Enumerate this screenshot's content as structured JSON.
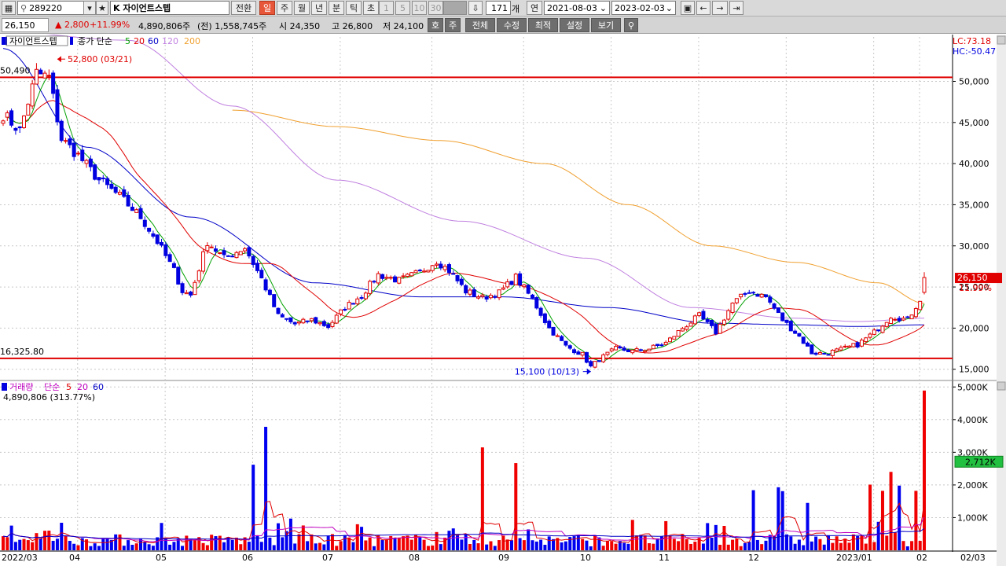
{
  "toolbar": {
    "stock_code": "289220",
    "stock_name": "K 자이언트스텝",
    "convert_label": "전환",
    "period_tabs": [
      "일",
      "주",
      "월",
      "년",
      "분",
      "틱",
      "초"
    ],
    "selected_period": "일",
    "interval_options": [
      "1",
      "5",
      "10",
      "30"
    ],
    "count_value": "171",
    "count_unit": "개",
    "year_label": "연",
    "start_date": "2021-08-03",
    "end_date": "2023-02-03"
  },
  "quote": {
    "price": "26,150",
    "change": "▲ 2,800",
    "change_pct": "+11.99%",
    "volume": "4,890,806주",
    "prev_volume": "(전) 1,558,745주",
    "open": "시 24,350",
    "high": "고 26,800",
    "low": "저 24,100",
    "buttons": [
      "호",
      "주",
      "전체",
      "수정",
      "최적",
      "설정",
      "보기"
    ]
  },
  "legend": {
    "price_title": "자이언트스텝",
    "ma_label": "종가 단순",
    "ma_periods": [
      "5",
      "20",
      "60",
      "120",
      "200"
    ],
    "ma_colors": [
      "#00a000",
      "#e00000",
      "#0000c8",
      "#c080e0",
      "#f0a030"
    ],
    "volume_title": "거래량",
    "volume_ma_label": "단순",
    "volume_ma_periods": [
      "5",
      "20",
      "60"
    ],
    "volume_ma_colors": [
      "#e00000",
      "#c000c0",
      "#0000c8"
    ],
    "volume_info": "4,890,806 (313.77%)"
  },
  "annotations": {
    "lc": "LC:73.18",
    "hc": "HC:-50.47",
    "high_point": "52,800 (03/21)",
    "low_point": "15,100 (10/13)",
    "resistance_label": "50,490",
    "support_label": "16,325.80",
    "current_price_tag": "26,150",
    "current_pct": "11.99%",
    "volume_tag": "2,712K",
    "resistance_value": 50490,
    "support_value": 16325.8
  },
  "chart_data": {
    "type": "candlestick",
    "price_axis": {
      "ticks": [
        15000,
        20000,
        25000,
        30000,
        35000,
        40000,
        45000,
        50000
      ],
      "tick_labels": [
        "15,000",
        "20,000",
        "25,000",
        "30,000",
        "35,000",
        "40,000",
        "45,000",
        "50,000"
      ]
    },
    "volume_axis": {
      "ticks": [
        1000,
        2000,
        3000,
        4000,
        5000
      ],
      "tick_labels": [
        "1,000K",
        "2,000K",
        "3,000K",
        "4,000K",
        "5,000K"
      ]
    },
    "x_labels": [
      "2022/03",
      "04",
      "05",
      "06",
      "07",
      "08",
      "09",
      "10",
      "11",
      "12",
      "2023/01",
      "02",
      "02/03"
    ],
    "close_path": [
      [
        0,
        46000
      ],
      [
        4,
        44000
      ],
      [
        8,
        51000
      ],
      [
        11,
        50500
      ],
      [
        14,
        43000
      ],
      [
        18,
        41000
      ],
      [
        23,
        38000
      ],
      [
        28,
        36000
      ],
      [
        33,
        33500
      ],
      [
        37,
        30500
      ],
      [
        41,
        27000
      ],
      [
        43,
        24500
      ],
      [
        45,
        24000
      ],
      [
        49,
        30500
      ],
      [
        53,
        28500
      ],
      [
        58,
        29800
      ],
      [
        62,
        26000
      ],
      [
        66,
        21500
      ],
      [
        70,
        20500
      ],
      [
        74,
        21000
      ],
      [
        78,
        20200
      ],
      [
        82,
        22500
      ],
      [
        86,
        24000
      ],
      [
        90,
        26500
      ],
      [
        95,
        25800
      ],
      [
        100,
        26800
      ],
      [
        104,
        28200
      ],
      [
        107,
        27000
      ],
      [
        111,
        24500
      ],
      [
        115,
        23700
      ],
      [
        119,
        24300
      ],
      [
        123,
        26200
      ],
      [
        127,
        23500
      ],
      [
        131,
        20000
      ],
      [
        135,
        17800
      ],
      [
        139,
        16800
      ],
      [
        141,
        15300
      ],
      [
        143,
        16200
      ],
      [
        147,
        17500
      ],
      [
        151,
        17200
      ],
      [
        155,
        17500
      ],
      [
        159,
        18200
      ],
      [
        163,
        20000
      ],
      [
        167,
        21500
      ],
      [
        171,
        19500
      ],
      [
        175,
        23000
      ],
      [
        179,
        24500
      ],
      [
        183,
        23800
      ],
      [
        187,
        21000
      ],
      [
        191,
        19000
      ],
      [
        194,
        17000
      ],
      [
        197,
        16900
      ],
      [
        201,
        17400
      ],
      [
        205,
        18000
      ],
      [
        209,
        19500
      ],
      [
        213,
        21500
      ],
      [
        217,
        21000
      ],
      [
        220,
        23500
      ],
      [
        221,
        26150
      ]
    ],
    "vol_hot": [
      [
        63,
        3780
      ],
      [
        60,
        2620
      ],
      [
        69,
        970
      ],
      [
        115,
        3150
      ],
      [
        123,
        2670
      ],
      [
        151,
        930
      ],
      [
        180,
        1840
      ],
      [
        186,
        1930
      ],
      [
        187,
        1810
      ],
      [
        193,
        1450
      ],
      [
        208,
        2010
      ],
      [
        211,
        1820
      ],
      [
        213,
        2400
      ],
      [
        215,
        1980
      ],
      [
        219,
        1820
      ],
      [
        221,
        4890
      ]
    ],
    "ma_curves": {
      "ma5": "close-path smoothing",
      "ma20": "lagged smoothing",
      "ma60": [
        [
          0,
          54000
        ],
        [
          20,
          42000
        ],
        [
          45,
          33500
        ],
        [
          75,
          25500
        ],
        [
          100,
          23800
        ],
        [
          120,
          23800
        ],
        [
          145,
          22500
        ],
        [
          170,
          20600
        ],
        [
          190,
          20400
        ],
        [
          205,
          20200
        ],
        [
          221,
          20400
        ]
      ],
      "ma120": [
        [
          0,
          56000
        ],
        [
          30,
          55000
        ],
        [
          55,
          47000
        ],
        [
          80,
          38000
        ],
        [
          110,
          33000
        ],
        [
          140,
          28500
        ],
        [
          165,
          22500
        ],
        [
          190,
          21200
        ],
        [
          205,
          20800
        ],
        [
          221,
          21200
        ]
      ],
      "ma200": [
        [
          55,
          46500
        ],
        [
          80,
          44500
        ],
        [
          105,
          42800
        ],
        [
          130,
          40000
        ],
        [
          150,
          35000
        ],
        [
          170,
          30000
        ],
        [
          190,
          28000
        ],
        [
          210,
          25500
        ],
        [
          221,
          23000
        ]
      ]
    }
  }
}
